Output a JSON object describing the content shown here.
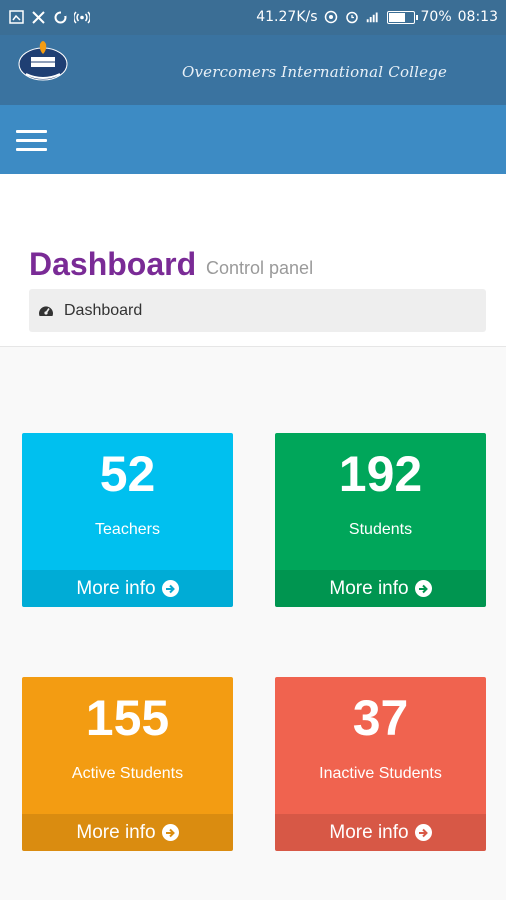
{
  "status_bar": {
    "speed": "41.27K/s",
    "battery": "70%",
    "battery_level": 0.7,
    "time": "08:13"
  },
  "header": {
    "college_name": "Overcomers International College"
  },
  "content_header": {
    "title": "Dashboard",
    "subtitle": "Control panel",
    "breadcrumb": "Dashboard"
  },
  "stats": [
    {
      "value": "52",
      "label": "Teachers",
      "link": "More info",
      "color": "#00c0ef"
    },
    {
      "value": "192",
      "label": "Students",
      "link": "More info",
      "color": "#00a65a"
    },
    {
      "value": "155",
      "label": "Active Students",
      "link": "More info",
      "color": "#f39c12"
    },
    {
      "value": "37",
      "label": "Inactive Students",
      "link": "More info",
      "color": "#f0634f"
    }
  ],
  "colors": {
    "accent": "#7a2b96",
    "navbar": "#3d8bc4",
    "brandbar": "#3a73a0"
  }
}
